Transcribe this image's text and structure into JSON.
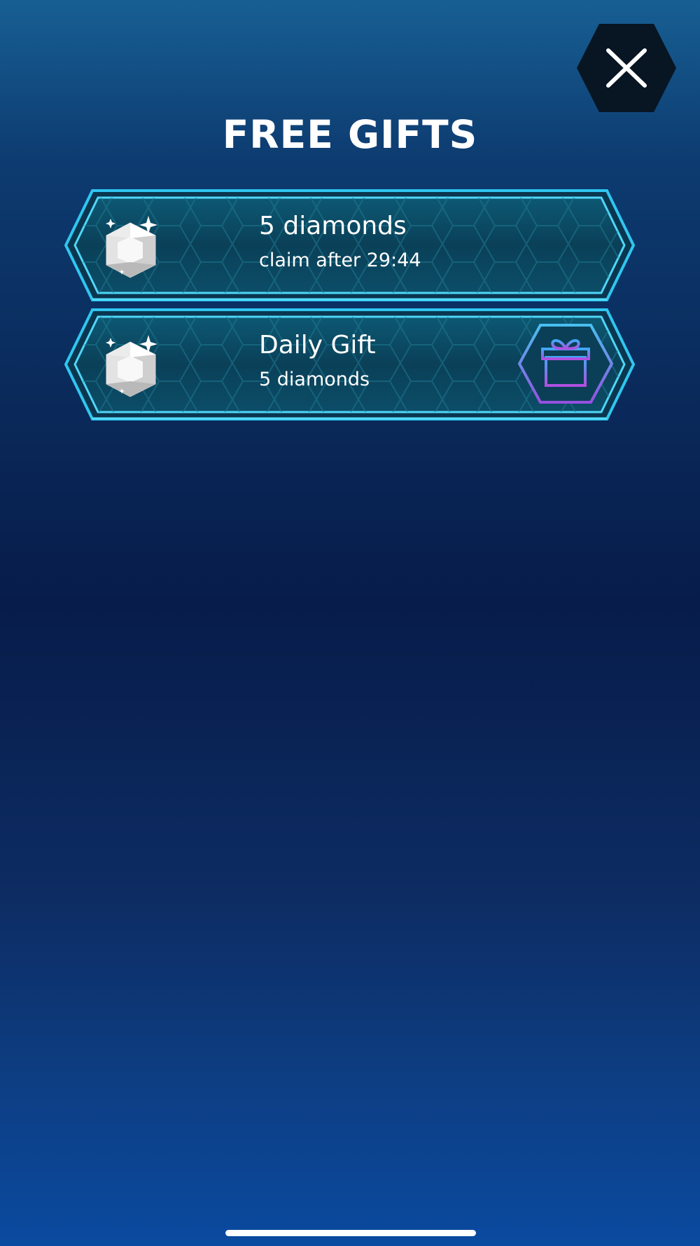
{
  "header": {
    "title": "FREE GIFTS",
    "close_icon": "close-x-icon"
  },
  "gifts": [
    {
      "title": "5 diamonds",
      "subtitle": "claim after 29:44",
      "icon": "diamond-gem-icon"
    },
    {
      "title": "Daily Gift",
      "subtitle": "5 diamonds",
      "icon": "diamond-gem-icon",
      "action_icon": "gift-box-icon"
    }
  ],
  "colors": {
    "frame_accent": "#2fc6f0",
    "card_fill": "#0c4e6a",
    "close_button_bg": "#081523",
    "gift_gradient_start": "#3fa9f5",
    "gift_gradient_end": "#b14fe0"
  }
}
